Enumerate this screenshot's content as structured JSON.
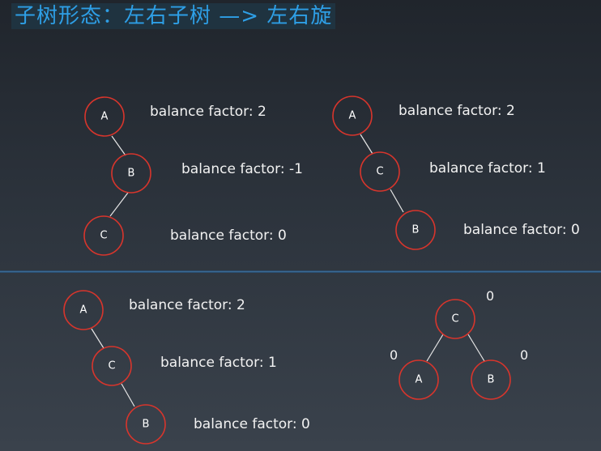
{
  "title": "子树形态：左右子树 —> 左右旋",
  "panel1": {
    "nodes": [
      "A",
      "B",
      "C"
    ],
    "factors": [
      "balance factor: 2",
      "balance factor: -1",
      "balance factor: 0"
    ]
  },
  "panel2": {
    "nodes": [
      "A",
      "C",
      "B"
    ],
    "factors": [
      "balance factor: 2",
      "balance factor: 1",
      "balance factor: 0"
    ]
  },
  "panel3": {
    "nodes": [
      "A",
      "C",
      "B"
    ],
    "factors": [
      "balance factor: 2",
      "balance factor: 1",
      "balance factor: 0"
    ]
  },
  "panel4": {
    "nodes": [
      "C",
      "A",
      "B"
    ],
    "factors": [
      "0",
      "0",
      "0"
    ]
  },
  "colors": {
    "title": "#2e9fe6",
    "node_stroke": "#d8352c",
    "text": "#f2f2f2"
  }
}
